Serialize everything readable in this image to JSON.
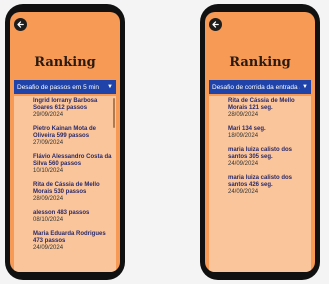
{
  "phones": [
    {
      "title": "Ranking",
      "challenge": "Desafio de passos em 5 min",
      "entries": [
        {
          "lines": [
            "Ingrid Iorrany Barbosa",
            "Soares  612 passos"
          ],
          "date": "29/09/2024"
        },
        {
          "lines": [
            "Pietro Kainan Mota de",
            "Oliveira  599 passos"
          ],
          "date": "27/09/2024"
        },
        {
          "lines": [
            "Flávio Alessandro Costa da",
            "Silva  560 passos"
          ],
          "date": "10/10/2024"
        },
        {
          "lines": [
            "Rita de Cássia de Mello",
            "Morais 530 passos"
          ],
          "date": "28/09/2024"
        },
        {
          "lines": [
            "alesson 483 passos"
          ],
          "date": "08/10/2024"
        },
        {
          "lines": [
            "Maria Eduarda Rodrigues",
            "473 passos"
          ],
          "date": "24/09/2024"
        }
      ]
    },
    {
      "title": "Ranking",
      "challenge": "Desafio de corrida da entrada à...",
      "entries": [
        {
          "lines": [
            "Rita de Cássia de Mello",
            "Morais 121 seg."
          ],
          "date": "28/09/2024"
        },
        {
          "lines": [
            "Mari 134 seg."
          ],
          "date": "18/09/2024"
        },
        {
          "lines": [
            "maria luiza calisto dos",
            "santos 305 seg."
          ],
          "date": "24/09/2024"
        },
        {
          "lines": [
            "maria luiza calisto dos",
            "santos 426 seg."
          ],
          "date": "24/09/2024"
        }
      ]
    }
  ],
  "icons": {
    "back": "back-arrow-icon",
    "dropdown": "chevron-down-icon"
  }
}
